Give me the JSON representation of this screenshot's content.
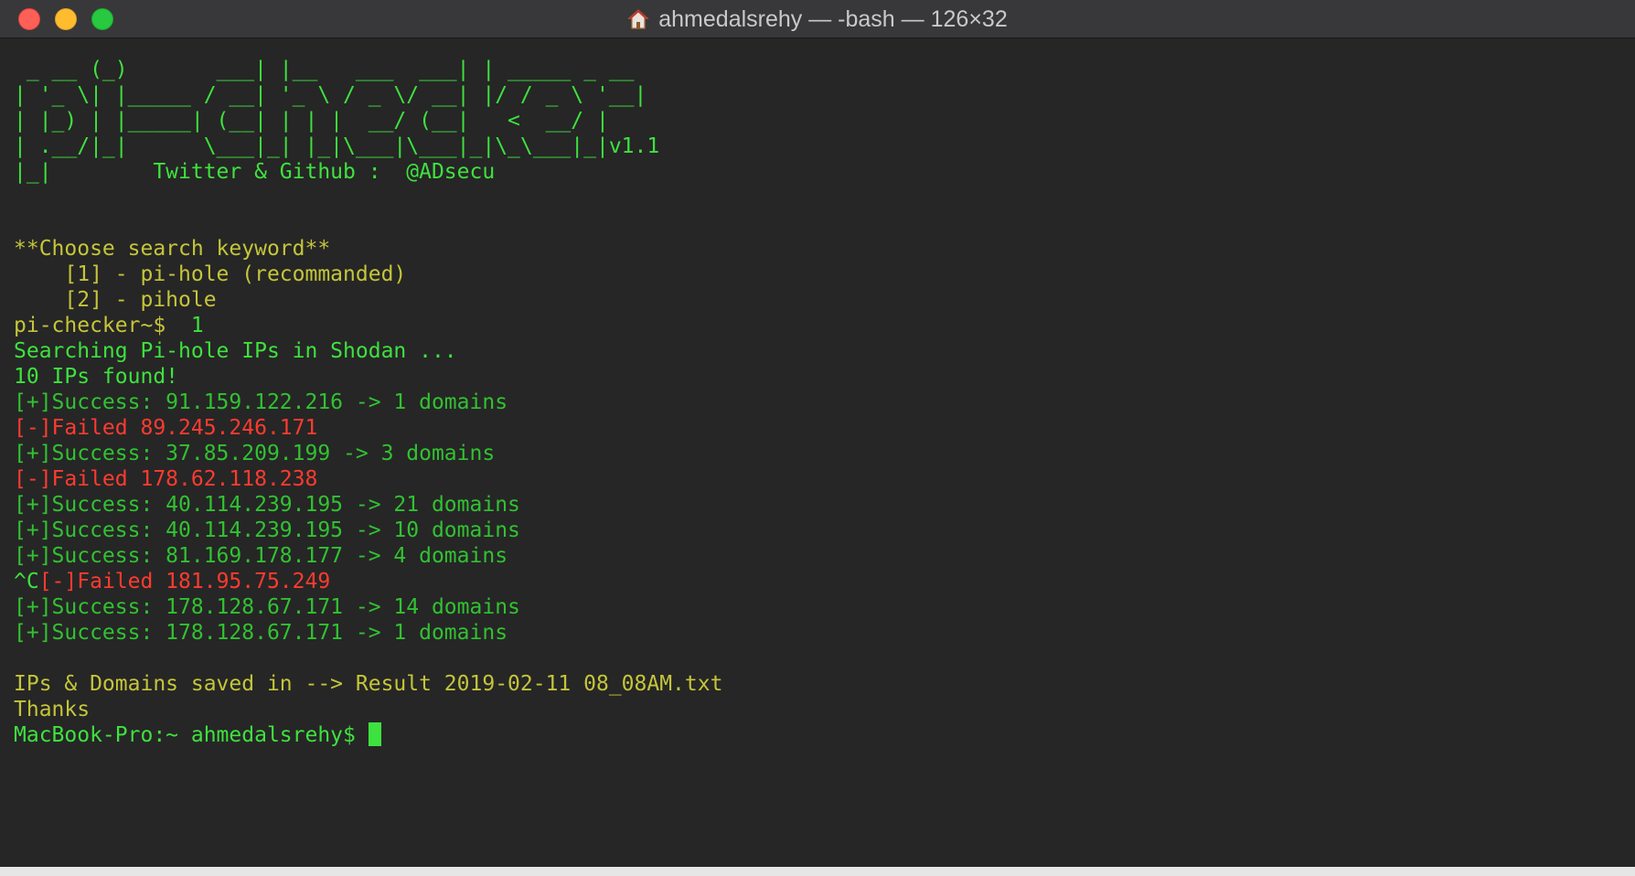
{
  "window": {
    "title": "ahmedalsrehy — -bash — 126×32",
    "traffic_lights": [
      "close",
      "minimize",
      "zoom"
    ],
    "home_icon": "home-icon"
  },
  "colors": {
    "background": "#262626",
    "green": "#3ee23e",
    "yellow": "#c5c53a",
    "red": "#ff3b30"
  },
  "terminal": {
    "ascii_banner": [
      " _ __ (_)       ___| |__   ___  ___| | _____ _ __ ",
      "| '_ \\| |_____ / __| '_ \\ / _ \\/ __| |/ / _ \\ '__|",
      "| |_) | |_____| (__| | | |  __/ (__|   <  __/ |   ",
      "| .__/|_|      \\___|_| |_|\\___|\\___|_|\\_\\___|_|",
      "|_|"
    ],
    "version": "v1.1",
    "credit": "        Twitter & Github :  @ADsecu",
    "menu_title": "**Choose search keyword**",
    "menu_options": [
      "    [1] - pi-hole (recommanded)",
      "    [2] - pihole"
    ],
    "prompt": "pi-checker~$ ",
    "prompt_input": " 1",
    "searching": "Searching Pi-hole IPs in Shodan ...",
    "found": "10 IPs found!",
    "results": [
      {
        "status": "success",
        "text": "[+]Success: 91.159.122.216 -> 1 domains"
      },
      {
        "status": "failed",
        "text": "[-]Failed 89.245.246.171"
      },
      {
        "status": "success",
        "text": "[+]Success: 37.85.209.199 -> 3 domains"
      },
      {
        "status": "failed",
        "text": "[-]Failed 178.62.118.238"
      },
      {
        "status": "success",
        "text": "[+]Success: 40.114.239.195 -> 21 domains"
      },
      {
        "status": "success",
        "text": "[+]Success: 40.114.239.195 -> 10 domains"
      },
      {
        "status": "success",
        "text": "[+]Success: 81.169.178.177 -> 4 domains"
      },
      {
        "status": "failed",
        "prefix": "^C",
        "text": "[-]Failed 181.95.75.249"
      },
      {
        "status": "success",
        "text": "[+]Success: 178.128.67.171 -> 14 domains"
      },
      {
        "status": "success",
        "text": "[+]Success: 178.128.67.171 -> 1 domains"
      }
    ],
    "saved": "IPs & Domains saved in --> Result 2019-02-11 08_08AM.txt",
    "thanks": "Thanks",
    "shell_prompt": "MacBook-Pro:~ ahmedalsrehy$ "
  }
}
